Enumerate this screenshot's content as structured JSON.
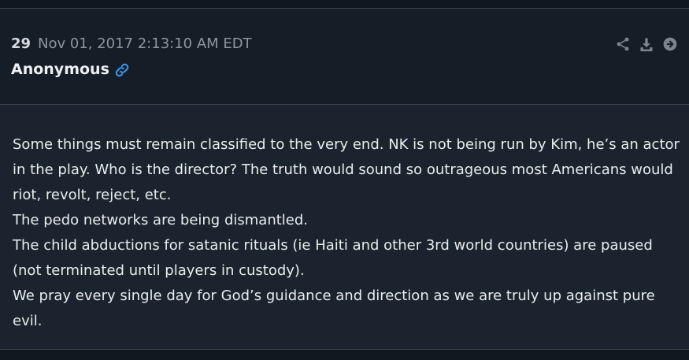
{
  "post": {
    "number": "29",
    "timestamp": "Nov 01, 2017 2:13:10 AM EDT",
    "author": "Anonymous",
    "actions": {
      "share_icon": "share-icon",
      "download_icon": "download-icon",
      "next_icon": "arrow-right-circle-icon"
    },
    "body_lines": [
      "Some things must remain classified to the very end. NK is not being run by Kim, he’s an actor in the play. Who is the director? The truth would sound so outrageous most Americans would riot, revolt, reject, etc.",
      "The pedo networks are being dismantled.",
      "The child abductions for satanic rituals (ie Haiti and other 3rd world countries) are paused (not terminated until players in custody).",
      "We pray every single day for God’s guidance and direction as we are truly up against pure evil."
    ]
  },
  "colors": {
    "background": "#101820",
    "header_bg": "#151d27",
    "body_bg": "#1b242e",
    "divider": "#3a4451",
    "link_blue": "#3b8fe0",
    "icon_gray": "#7d8590"
  }
}
